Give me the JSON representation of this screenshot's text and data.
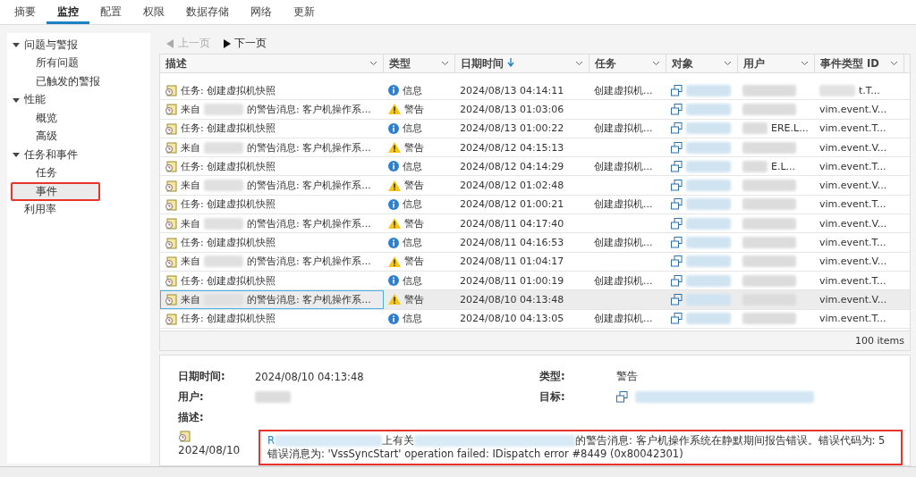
{
  "tabs": [
    {
      "label": "摘要",
      "selected": false
    },
    {
      "label": "监控",
      "selected": true
    },
    {
      "label": "配置",
      "selected": false
    },
    {
      "label": "权限",
      "selected": false
    },
    {
      "label": "数据存储",
      "selected": false
    },
    {
      "label": "网络",
      "selected": false
    },
    {
      "label": "更新",
      "selected": false
    }
  ],
  "sidebar": {
    "items": [
      {
        "label": "问题与警报",
        "expanded": true,
        "selected": false,
        "children": [
          {
            "label": "所有问题",
            "selected": false
          },
          {
            "label": "已触发的警报",
            "selected": false
          }
        ]
      },
      {
        "label": "性能",
        "expanded": true,
        "selected": false,
        "children": [
          {
            "label": "概览",
            "selected": false
          },
          {
            "label": "高级",
            "selected": false
          }
        ]
      },
      {
        "label": "任务和事件",
        "expanded": true,
        "selected": false,
        "children": [
          {
            "label": "任务",
            "selected": false
          },
          {
            "label": "事件",
            "selected": true,
            "annotated": true
          }
        ]
      },
      {
        "label": "利用率",
        "selected": false
      }
    ]
  },
  "pager": [
    {
      "label": "上一页",
      "disabled": true
    },
    {
      "label": "下一页",
      "disabled": false
    }
  ],
  "table": {
    "columns": [
      {
        "label": "描述",
        "sorted": false
      },
      {
        "label": "类型",
        "sorted": false
      },
      {
        "label": "日期时间",
        "sorted": true
      },
      {
        "label": "任务",
        "sorted": false
      },
      {
        "label": "对象",
        "sorted": false
      },
      {
        "label": "用户",
        "sorted": false
      },
      {
        "label": "事件类型 ID",
        "sorted": false
      }
    ],
    "rows": [
      {
        "kind": "task",
        "description": "任务: 创建虚拟机快照",
        "type": "信息",
        "datetime": "2024/08/13 04:14:11",
        "task": "创建虚拟机...",
        "event_id": "t.T...",
        "selected": false
      },
      {
        "kind": "warning",
        "prefix": "来自",
        "description": "的警告消息: 客户机操作系...",
        "type": "警告",
        "datetime": "2024/08/13 01:03:06",
        "event_id": "vim.event.V...",
        "selected": false
      },
      {
        "kind": "task",
        "description": "任务: 创建虚拟机快照",
        "type": "信息",
        "datetime": "2024/08/13 01:00:22",
        "task": "创建虚拟机...",
        "user": "ERE.L...",
        "event_id": "vim.event.T...",
        "selected": false
      },
      {
        "kind": "warning",
        "prefix": "来自",
        "description": "的警告消息: 客户机操作系...",
        "type": "警告",
        "datetime": "2024/08/12 04:15:13",
        "event_id": "vim.event.V...",
        "selected": false
      },
      {
        "kind": "task",
        "description": "任务: 创建虚拟机快照",
        "type": "信息",
        "datetime": "2024/08/12 04:14:29",
        "task": "创建虚拟机...",
        "user": "E.L...",
        "event_id": "vim.event.T...",
        "selected": false
      },
      {
        "kind": "warning",
        "prefix": "来自",
        "description": "的警告消息: 客户机操作系...",
        "type": "警告",
        "datetime": "2024/08/12 01:02:48",
        "event_id": "vim.event.V...",
        "selected": false
      },
      {
        "kind": "task",
        "description": "任务: 创建虚拟机快照",
        "type": "信息",
        "datetime": "2024/08/12 01:00:21",
        "task": "创建虚拟机...",
        "event_id": "vim.event.T...",
        "selected": false
      },
      {
        "kind": "warning",
        "prefix": "来自",
        "description": "的警告消息: 客户机操作系...",
        "type": "警告",
        "datetime": "2024/08/11 04:17:40",
        "event_id": "vim.event.V...",
        "selected": false
      },
      {
        "kind": "task",
        "description": "任务: 创建虚拟机快照",
        "type": "信息",
        "datetime": "2024/08/11 04:16:53",
        "task": "创建虚拟机...",
        "event_id": "vim.event.T...",
        "selected": false
      },
      {
        "kind": "warning",
        "prefix": "来自",
        "description": "的警告消息: 客户机操作系...",
        "type": "警告",
        "datetime": "2024/08/11 01:04:17",
        "event_id": "vim.event.V...",
        "selected": false
      },
      {
        "kind": "task",
        "description": "任务: 创建虚拟机快照",
        "type": "信息",
        "datetime": "2024/08/11 01:00:19",
        "task": "创建虚拟机...",
        "event_id": "vim.event.T...",
        "selected": false
      },
      {
        "kind": "warning",
        "prefix": "来自",
        "description": "的警告消息: 客户机操作系...",
        "type": "警告",
        "datetime": "2024/08/10 04:13:48",
        "event_id": "vim.event.V...",
        "selected": true
      },
      {
        "kind": "task",
        "description": "任务: 创建虚拟机快照",
        "type": "信息",
        "datetime": "2024/08/10 04:13:05",
        "task": "创建虚拟机...",
        "event_id": "vim.event.T...",
        "selected": false
      }
    ],
    "footer": "100 items"
  },
  "details": {
    "fields": [
      {
        "label": "日期时间:",
        "value": "2024/08/10 04:13:48"
      },
      {
        "label": "类型:",
        "value": "警告"
      },
      {
        "label": "用户:",
        "kind": "redacted"
      },
      {
        "label": "目标:",
        "kind": "link"
      }
    ],
    "description_label": "描述:",
    "date": "2024/08/10",
    "message_lead": "R",
    "message_mid": "上有关",
    "message": "的警告消息: 客户机操作系统在静默期间报告错误。错误代码为: 5 错误消息为: 'VssSyncStart' operation failed: IDispatch error #8449 (0x80042301)",
    "annotated": true
  }
}
